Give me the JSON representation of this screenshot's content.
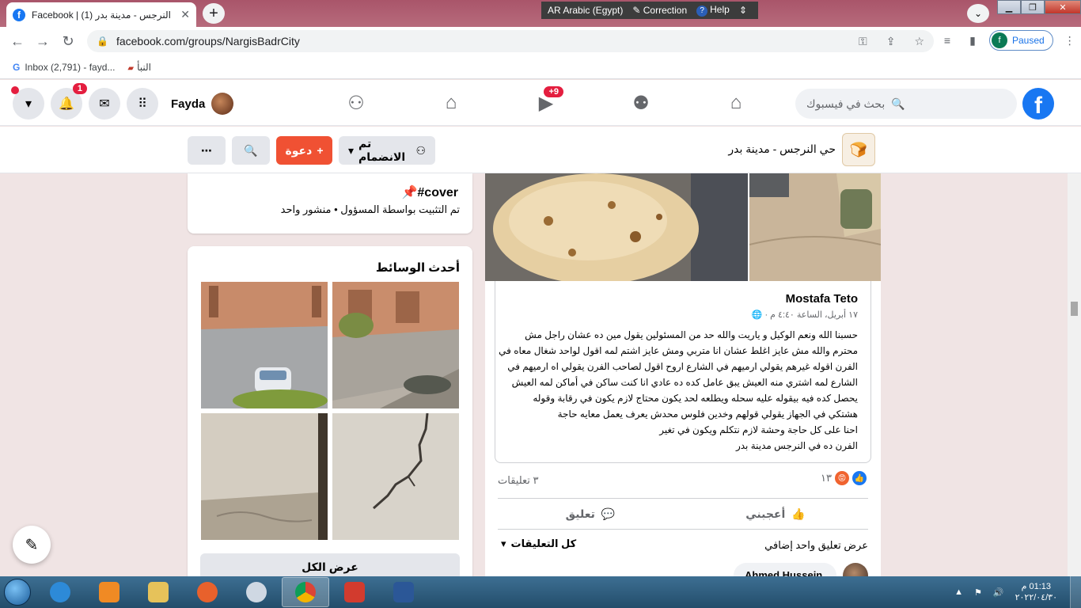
{
  "browser": {
    "tab_title": "Facebook | حي النرجس - مدينة بدر (1)",
    "url": "facebook.com/groups/NargisBadrCity",
    "profile_initial": "f",
    "profile_status": "Paused",
    "bookmarks": [
      {
        "label": "Inbox (2,791) - fayd..."
      },
      {
        "label": "النبأ"
      }
    ]
  },
  "language_bar": {
    "language": "AR Arabic (Egypt)",
    "correction": "Correction",
    "help": "Help"
  },
  "facebook_bar": {
    "search_placeholder": "بحث في فيسبوك",
    "user_name": "Fayda",
    "notifications_badge": "1",
    "watch_badge": "+9"
  },
  "group_header": {
    "name": "حي النرجس - مدينة بدر",
    "joined_label": "تم الانضمام",
    "invite_label": "دعوة"
  },
  "pinned": {
    "title": "#cover",
    "subtitle": "تم التثبيت بواسطة المسؤول • منشور واحد"
  },
  "media": {
    "title": "أحدث الوسائط",
    "view_all": "عرض الكل"
  },
  "post": {
    "author": "Mostafa Teto",
    "meta": "١٧ أبريل، الساعة ٤:٤٠ م ·",
    "body_lines": [
      "حسبنا الله ونعم الوكيل و ياريت والله حد من المسئولين يقول مين ده عشان راجل مش",
      "محترم والله مش عايز اغلط عشان انا متربي ومش عايز اشتم لمه اقول لواحد شغال معاه في",
      "الفرن اقوله غيرهم يقولي ارميهم في الشارع اروح اقول لصاحب الفرن يقولي اه ارميهم في",
      "الشارع لمه اشتري منه العيش يبق عامل كده ده عادي انا كنت ساكن في أماكن لمه العيش",
      "يحصل كده فيه بيقوله عليه سحله ويطلعه لحد يكون محتاج لازم يكون في رقابة وقوله",
      "هشتكي في الجهاز يقولي  قولهم وخدين فلوس محدش يعرف يعمل معايه حاجة",
      "احنا على كل حاجة وحشة لازم نتكلم ويكون في تغير",
      " الفرن ده في النرجس مدينة بدر"
    ],
    "reactions_count": "١٣",
    "comments_count": "٣ تعليقات",
    "like_label": "أعجبني",
    "comment_label": "تعليق",
    "more_comments": "عرض تعليق واحد إضافي",
    "all_comments": "كل التعليقات",
    "first_commenter": "Ahmed Hussein"
  },
  "taskbar": {
    "time": "01:13 م",
    "date": "٢٠٢٢/٠٤/٣٠"
  }
}
